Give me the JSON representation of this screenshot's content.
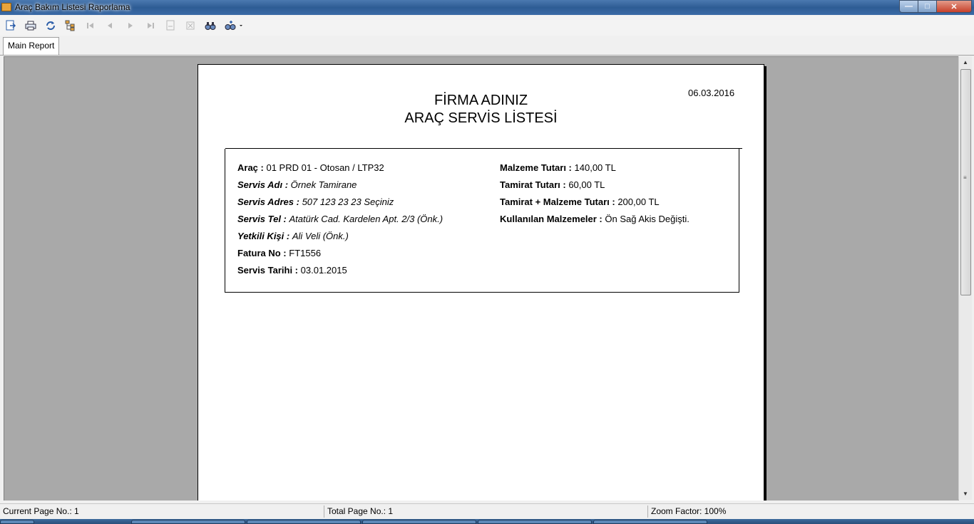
{
  "window": {
    "title": "Araç Bakım Listesi Raporlama",
    "buttons": {
      "minimize": "—",
      "maximize": "□",
      "close": "✕"
    }
  },
  "toolbar": {
    "icons": [
      "export-icon",
      "print-icon",
      "refresh-icon",
      "group-tree-icon",
      "first-page-icon",
      "previous-page-icon",
      "next-page-icon",
      "last-page-icon",
      "goto-page-icon",
      "stop-icon",
      "find-icon",
      "zoom-icon"
    ]
  },
  "tabs": {
    "main": "Main Report"
  },
  "report": {
    "date": "06.03.2016",
    "title_line1": "FİRMA ADINIZ",
    "title_line2": "ARAÇ SERVİS LİSTESİ",
    "left": [
      {
        "label": "Araç :",
        "value": "01 PRD 01 - Otosan / LTP32"
      },
      {
        "label": "Servis Adı :",
        "value": "Örnek Tamirane"
      },
      {
        "label": "Servis Adres :",
        "value": "507 123 23 23 Seçiniz"
      },
      {
        "label": "Servis Tel :",
        "value": "Atatürk Cad. Kardelen Apt. 2/3 (Önk.)"
      },
      {
        "label": "Yetkili Kişi :",
        "value": "Ali Veli (Önk.)"
      },
      {
        "label": "Fatura No :",
        "value": "FT1556"
      },
      {
        "label": "Servis Tarihi :",
        "value": "03.01.2015"
      }
    ],
    "right": [
      {
        "label": "Malzeme Tutarı :",
        "value": "140,00 TL"
      },
      {
        "label": "Tamirat Tutarı :",
        "value": "60,00 TL"
      },
      {
        "label": "Tamirat + Malzeme Tutarı :",
        "value": "200,00 TL"
      },
      {
        "label": "Kullanılan Malzemeler :",
        "value": "Ön Sağ Akis Değişti."
      }
    ]
  },
  "status": {
    "current_page": "Current Page No.: 1",
    "total_page": "Total Page No.: 1",
    "zoom": "Zoom Factor: 100%"
  }
}
